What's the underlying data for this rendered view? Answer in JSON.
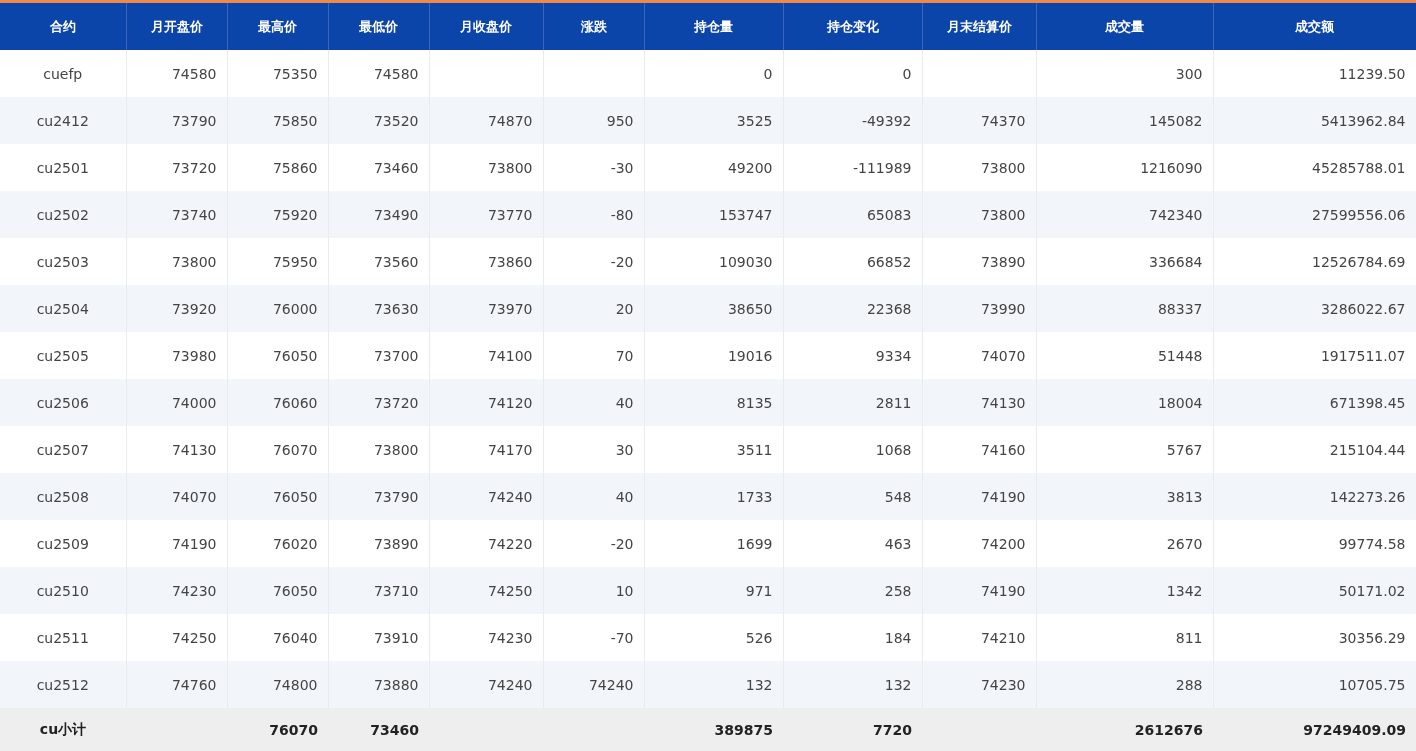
{
  "table": {
    "columns": [
      "合约",
      "月开盘价",
      "最高价",
      "最低价",
      "月收盘价",
      "涨跌",
      "持仓量",
      "持仓变化",
      "月末结算价",
      "成交量",
      "成交额"
    ],
    "rows": [
      [
        "cuefp",
        "74580",
        "75350",
        "74580",
        null,
        null,
        "0",
        "0",
        null,
        "300",
        "11239.50"
      ],
      [
        "cu2412",
        "73790",
        "75850",
        "73520",
        "74870",
        "950",
        "3525",
        "-49392",
        "74370",
        "145082",
        "5413962.84"
      ],
      [
        "cu2501",
        "73720",
        "75860",
        "73460",
        "73800",
        "-30",
        "49200",
        "-111989",
        "73800",
        "1216090",
        "45285788.01"
      ],
      [
        "cu2502",
        "73740",
        "75920",
        "73490",
        "73770",
        "-80",
        "153747",
        "65083",
        "73800",
        "742340",
        "27599556.06"
      ],
      [
        "cu2503",
        "73800",
        "75950",
        "73560",
        "73860",
        "-20",
        "109030",
        "66852",
        "73890",
        "336684",
        "12526784.69"
      ],
      [
        "cu2504",
        "73920",
        "76000",
        "73630",
        "73970",
        "20",
        "38650",
        "22368",
        "73990",
        "88337",
        "3286022.67"
      ],
      [
        "cu2505",
        "73980",
        "76050",
        "73700",
        "74100",
        "70",
        "19016",
        "9334",
        "74070",
        "51448",
        "1917511.07"
      ],
      [
        "cu2506",
        "74000",
        "76060",
        "73720",
        "74120",
        "40",
        "8135",
        "2811",
        "74130",
        "18004",
        "671398.45"
      ],
      [
        "cu2507",
        "74130",
        "76070",
        "73800",
        "74170",
        "30",
        "3511",
        "1068",
        "74160",
        "5767",
        "215104.44"
      ],
      [
        "cu2508",
        "74070",
        "76050",
        "73790",
        "74240",
        "40",
        "1733",
        "548",
        "74190",
        "3813",
        "142273.26"
      ],
      [
        "cu2509",
        "74190",
        "76020",
        "73890",
        "74220",
        "-20",
        "1699",
        "463",
        "74200",
        "2670",
        "99774.58"
      ],
      [
        "cu2510",
        "74230",
        "76050",
        "73710",
        "74250",
        "10",
        "971",
        "258",
        "74190",
        "1342",
        "50171.02"
      ],
      [
        "cu2511",
        "74250",
        "76040",
        "73910",
        "74230",
        "-70",
        "526",
        "184",
        "74210",
        "811",
        "30356.29"
      ],
      [
        "cu2512",
        "74760",
        "74800",
        "73880",
        "74240",
        "74240",
        "132",
        "132",
        "74230",
        "288",
        "10705.75"
      ]
    ],
    "subtotal": {
      "label": "cu小计",
      "high": "76070",
      "low": "73460",
      "open_interest": "389875",
      "open_interest_change": "7720",
      "volume": "2612676",
      "turnover": "97249409.09"
    }
  }
}
